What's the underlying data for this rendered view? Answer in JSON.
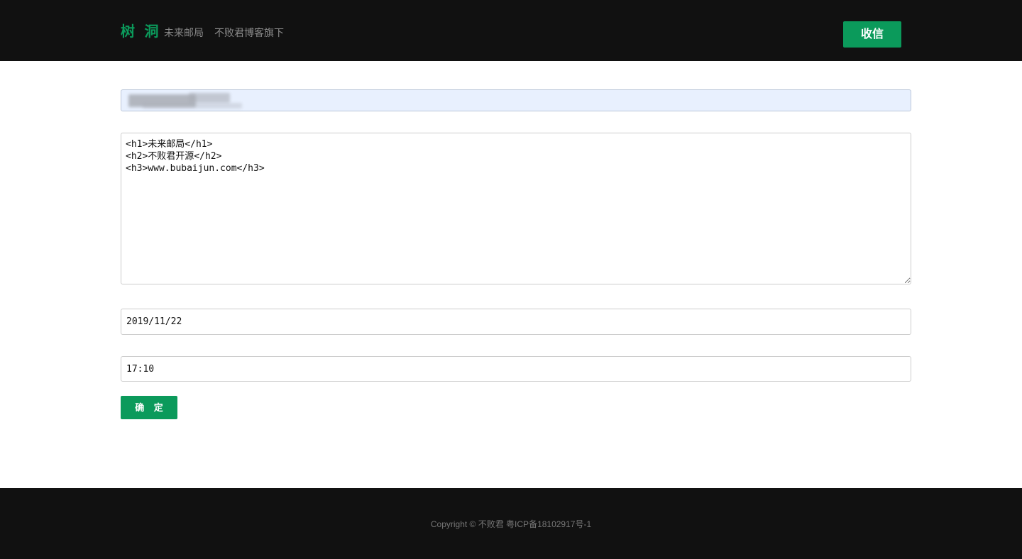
{
  "header": {
    "brand": "树 洞",
    "nav": [
      "未来邮局",
      "不败君博客旗下"
    ],
    "receive_button": "收信"
  },
  "form": {
    "email_value": "",
    "content_value": "<h1>未来邮局</h1>\n<h2>不败君开源</h2>\n<h3>www.bubaijun.com</h3>",
    "date_value": "2019/11/22",
    "time_value": "17:10",
    "submit_label": "确 定"
  },
  "footer": {
    "copyright": "Copyright © 不败君 粤ICP备18102917号-1"
  },
  "colors": {
    "header_bg": "#111111",
    "accent": "#0b9a5b",
    "autofill_bg": "#e8f0fe"
  }
}
